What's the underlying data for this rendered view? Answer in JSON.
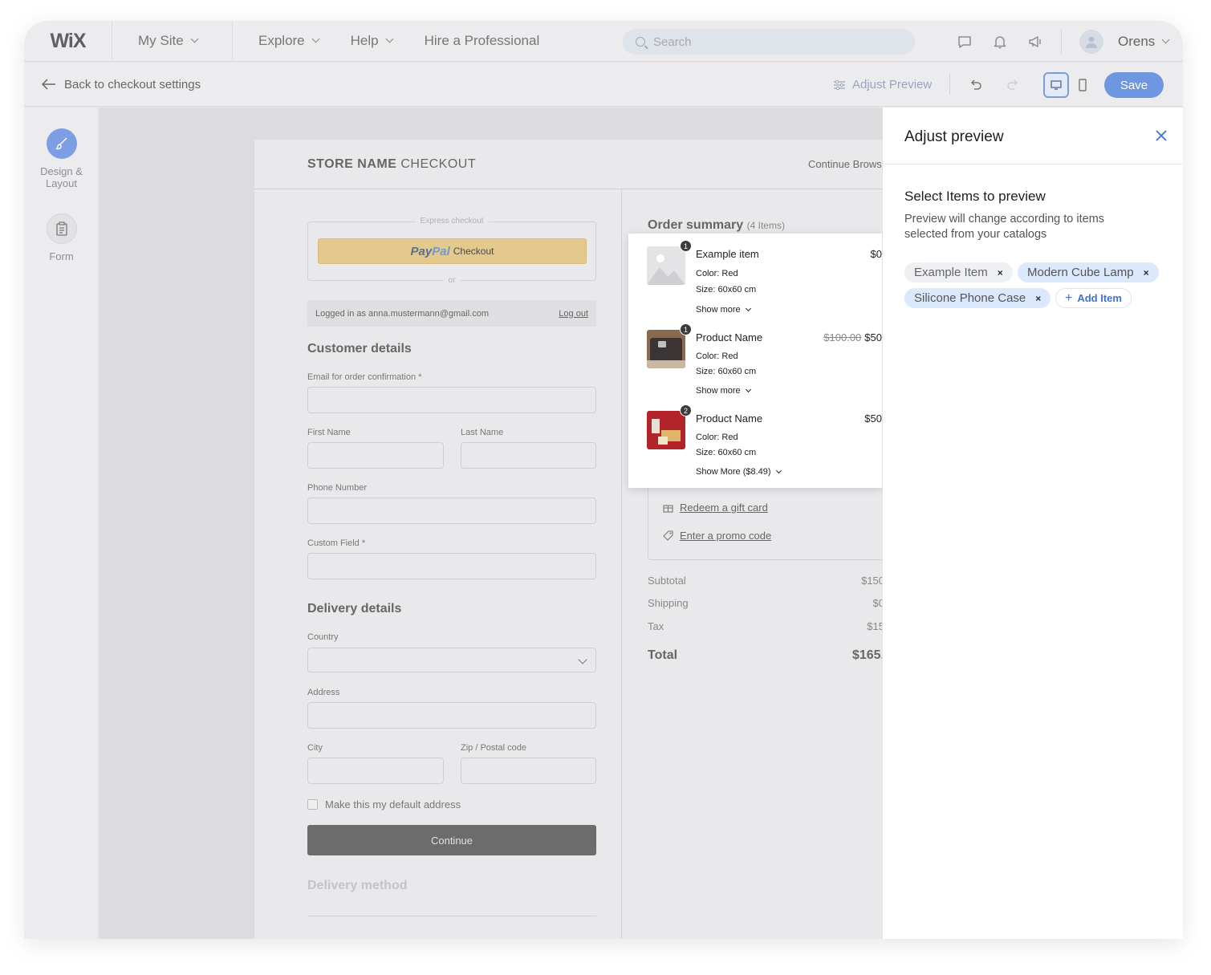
{
  "topbar": {
    "logo": "WiX",
    "site": "My Site",
    "nav": [
      "Explore",
      "Help",
      "Hire a Professional"
    ],
    "search_placeholder": "Search",
    "user": "Orens"
  },
  "subbar": {
    "back": "Back to checkout settings",
    "adjust": "Adjust Preview",
    "save": "Save"
  },
  "rail": {
    "design": "Design &",
    "design2": "Layout",
    "form": "Form"
  },
  "checkout": {
    "store_bold": "STORE NAME",
    "store_rest": " CHECKOUT",
    "continue_browsing": "Continue Brows",
    "express": "Express checkout",
    "paypal_a": "Pay",
    "paypal_b": "Pal",
    "paypal_label": "Checkout",
    "or": "or",
    "logged_in": "Logged in as anna.mustermann@gmail.com",
    "log_out": "Log out",
    "customer_title": "Customer details",
    "email_label": "Email for order confirmation *",
    "first_name": "First Name",
    "last_name": "Last Name",
    "phone": "Phone Number",
    "custom": "Custom Field  *",
    "delivery_title": "Delivery details",
    "country": "Country",
    "address": "Address",
    "city": "City",
    "zip": "Zip / Postal code",
    "default_address": "Make this my default address",
    "continue": "Continue",
    "delivery_method": "Delivery method"
  },
  "order": {
    "title": "Order summary",
    "count": "(4 Items)",
    "gift": "Redeem a gift card",
    "promo": "Enter a promo code",
    "subtotal_label": "Subtotal",
    "subtotal": "$150",
    "shipping_label": "Shipping",
    "shipping": "$0",
    "tax_label": "Tax",
    "tax": "$15",
    "total_label": "Total",
    "total": "$165."
  },
  "items": [
    {
      "qty": "1",
      "name": "Example item",
      "price": "$0",
      "old_price": "",
      "color": "Color: Red",
      "size": "Size: 60x60 cm",
      "more": "Show more"
    },
    {
      "qty": "1",
      "name": "Product Name",
      "price": "$50",
      "old_price": "$100.00",
      "color": "Color: Red",
      "size": "Size: 60x60 cm",
      "more": "Show more"
    },
    {
      "qty": "2",
      "name": "Product Name",
      "price": "$50",
      "old_price": "",
      "color": "Color: Red",
      "size": "Size: 60x60 cm",
      "more": "Show More ($8.49)"
    }
  ],
  "panel": {
    "title": "Adjust preview",
    "select_title": "Select Items to preview",
    "description": "Preview will change according to items selected from your catalogs",
    "tags": [
      "Example Item",
      "Modern Cube Lamp",
      "Silicone Phone Case"
    ],
    "tag_remove": "×",
    "add_item": "Add Item",
    "add_plus": "+"
  },
  "colors": {
    "accent": "#6f97df",
    "save_blue": "#6f97df",
    "link_blue": "#3f72d6",
    "tag_blue": "#dce8fb",
    "tag_gray": "#eef0f3"
  }
}
